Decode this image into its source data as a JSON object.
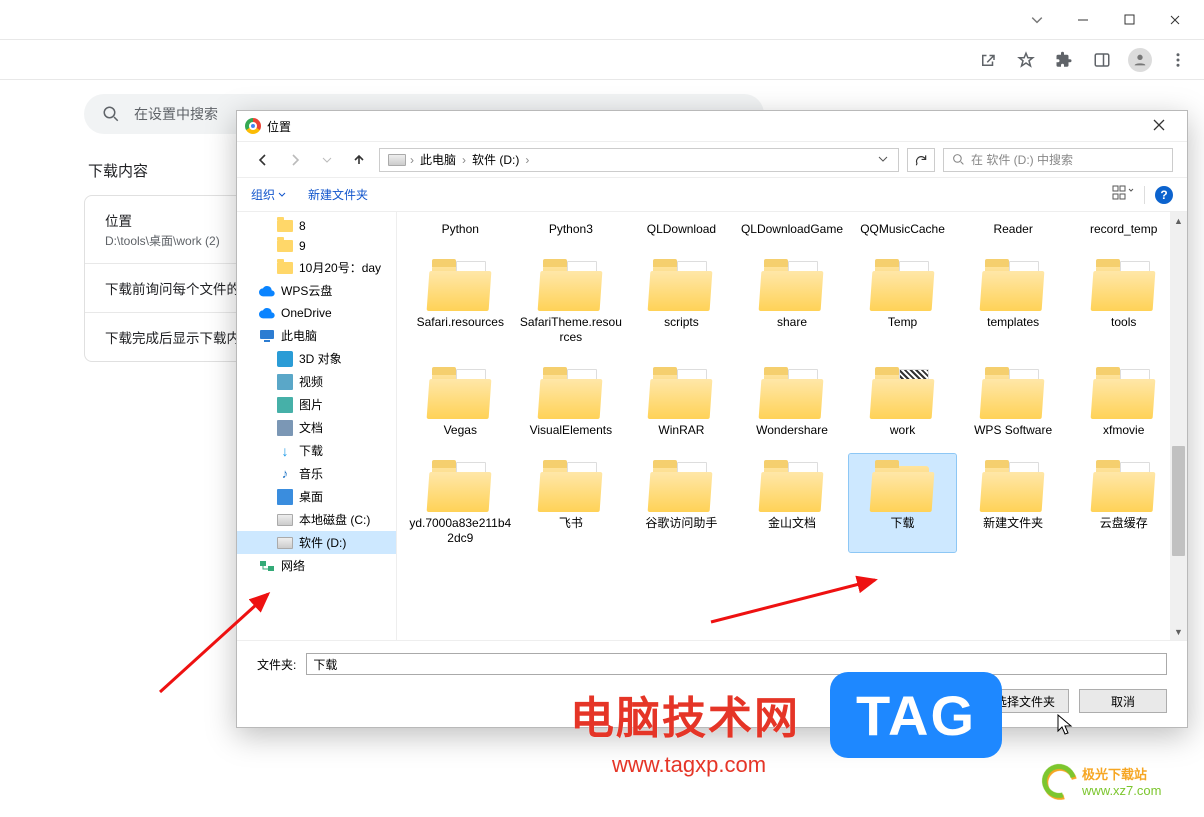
{
  "browser": {
    "search_placeholder": "在设置中搜索",
    "section_title": "下载内容",
    "rows": {
      "loc_label": "位置",
      "loc_value": "D:\\tools\\桌面\\work (2)",
      "ask_label": "下载前询问每个文件的保",
      "done_label": "下载完成后显示下载内容"
    }
  },
  "dialog": {
    "title": "位置",
    "nav": {
      "crumb_pc": "此电脑",
      "crumb_drive": "软件 (D:)",
      "refresh": "↻",
      "search_placeholder": "在 软件 (D:) 中搜索"
    },
    "toolbar": {
      "organize": "组织",
      "new_folder": "新建文件夹"
    },
    "tree": [
      {
        "lvl": 1,
        "icon": "folder",
        "label": "8"
      },
      {
        "lvl": 1,
        "icon": "folder",
        "label": "9"
      },
      {
        "lvl": 1,
        "icon": "folder",
        "label": "10月20号：day"
      },
      {
        "lvl": 0,
        "icon": "cloud",
        "label": "WPS云盘"
      },
      {
        "lvl": 0,
        "icon": "cloud",
        "label": "OneDrive"
      },
      {
        "lvl": 0,
        "icon": "pc",
        "label": "此电脑"
      },
      {
        "lvl": 1,
        "icon": "blue3d",
        "label": "3D 对象"
      },
      {
        "lvl": 1,
        "icon": "vid",
        "label": "视频"
      },
      {
        "lvl": 1,
        "icon": "pic",
        "label": "图片"
      },
      {
        "lvl": 1,
        "icon": "doc",
        "label": "文档"
      },
      {
        "lvl": 1,
        "icon": "dl",
        "label": "下载"
      },
      {
        "lvl": 1,
        "icon": "music",
        "label": "音乐"
      },
      {
        "lvl": 1,
        "icon": "desk",
        "label": "桌面"
      },
      {
        "lvl": 1,
        "icon": "disk",
        "label": "本地磁盘 (C:)"
      },
      {
        "lvl": 1,
        "icon": "disk",
        "label": "软件 (D:)",
        "sel": true
      },
      {
        "lvl": 0,
        "icon": "net",
        "label": "网络"
      }
    ],
    "folders_row0": [
      "Python",
      "Python3",
      "QLDownload",
      "QLDownloadGame",
      "QQMusicCache",
      "Reader",
      "record_temp"
    ],
    "folders_row1": [
      {
        "name": "Safari.resources",
        "paper": "plus"
      },
      {
        "name": "SafariTheme.resources",
        "paper": "plain"
      },
      {
        "name": "scripts",
        "paper": "plain"
      },
      {
        "name": "share",
        "paper": "plain"
      },
      {
        "name": "Temp",
        "paper": "plain"
      },
      {
        "name": "templates",
        "paper": "plain"
      },
      {
        "name": "tools",
        "paper": "plain"
      }
    ],
    "folders_row2": [
      {
        "name": "Vegas",
        "paper": "plain"
      },
      {
        "name": "VisualElements",
        "paper": "flame"
      },
      {
        "name": "WinRAR",
        "paper": "plain"
      },
      {
        "name": "Wondershare",
        "paper": "plain"
      },
      {
        "name": "work",
        "paper": "qr"
      },
      {
        "name": "WPS Software",
        "paper": "plain"
      },
      {
        "name": "xfmovie",
        "paper": "plain"
      }
    ],
    "folders_row3": [
      {
        "name": "yd.7000a83e211b42dc9",
        "paper": "plain"
      },
      {
        "name": "飞书",
        "paper": "plain"
      },
      {
        "name": "谷歌访问助手",
        "paper": "plain"
      },
      {
        "name": "金山文档",
        "paper": "plain"
      },
      {
        "name": "下载",
        "paper": "none",
        "sel": true
      },
      {
        "name": "新建文件夹",
        "paper": "plain"
      },
      {
        "name": "云盘缓存",
        "paper": "plain"
      }
    ],
    "footer": {
      "label": "文件夹:",
      "value": "下载",
      "select": "选择文件夹",
      "cancel": "取消"
    }
  },
  "overlay": {
    "watermark_text": "电脑技术网",
    "watermark_url": "www.tagxp.com",
    "tag_text": "TAG",
    "dl_site_name": "极光下载站",
    "dl_site_url": "www.xz7.com"
  }
}
